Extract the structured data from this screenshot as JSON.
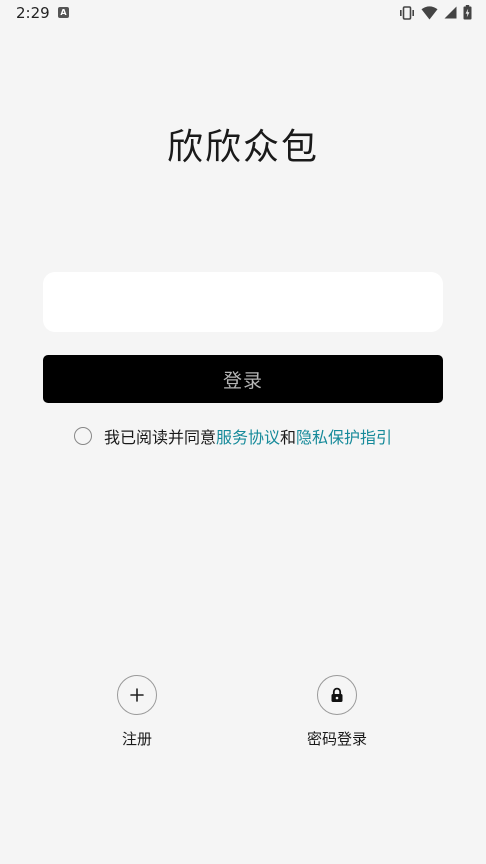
{
  "status_bar": {
    "time": "2:29",
    "app_icon_letter": "A",
    "icons": [
      "vibrate-icon",
      "wifi-icon",
      "signal-icon",
      "battery-charging-icon"
    ]
  },
  "app": {
    "title": "欣欣众包"
  },
  "login_form": {
    "phone_value": "",
    "phone_placeholder": "",
    "login_label": "登录"
  },
  "agreement": {
    "prefix": "我已阅读并同意",
    "service_link": "服务协议",
    "conjunction": "和",
    "privacy_link": "隐私保护指引",
    "checked": false
  },
  "bottom_options": {
    "register": {
      "label": "注册",
      "icon": "plus-icon"
    },
    "password_login": {
      "label": "密码登录",
      "icon": "lock-icon"
    }
  },
  "colors": {
    "background": "#f5f5f5",
    "button": "#000000",
    "button_text": "#b5b5b5",
    "link": "#168a9a"
  }
}
